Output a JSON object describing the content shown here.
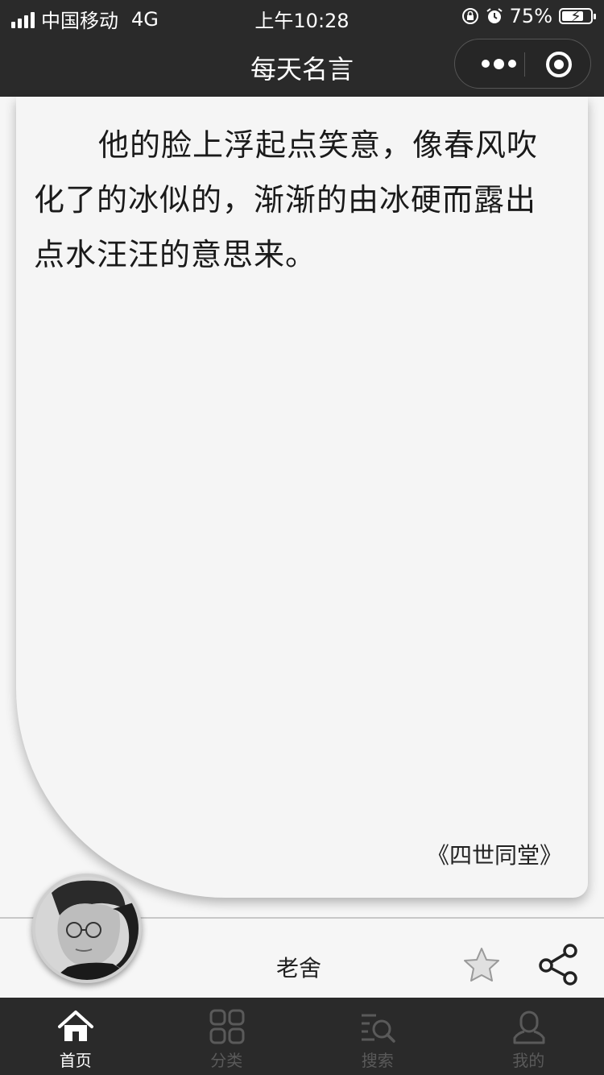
{
  "status_bar": {
    "carrier": "中国移动",
    "network": "4G",
    "time": "上午10:28",
    "battery_percent": "75%",
    "battery_level": 0.75
  },
  "nav": {
    "title": "每天名言"
  },
  "quote": {
    "text": "他的脸上浮起点笑意，像春风吹化了的冰似的，渐渐的由冰硬而露出点水汪汪的意思来。",
    "source": "《四世同堂》"
  },
  "author": {
    "name": "老舍"
  },
  "tabs": [
    {
      "label": "首页",
      "icon": "home-icon",
      "active": true
    },
    {
      "label": "分类",
      "icon": "grid-icon",
      "active": false
    },
    {
      "label": "搜索",
      "icon": "search-icon",
      "active": false
    },
    {
      "label": "我的",
      "icon": "user-icon",
      "active": false
    }
  ],
  "colors": {
    "bar_background": "#2a2a2a",
    "card_background": "#f5f5f5",
    "tab_active": "#ffffff",
    "tab_inactive": "#5a5a5a"
  }
}
